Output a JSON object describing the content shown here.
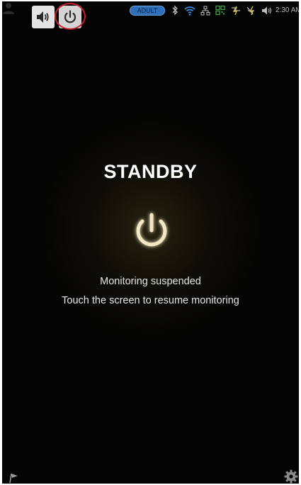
{
  "status_bar": {
    "patient_mode": "ADULT",
    "time": "2:30 AM",
    "icons": [
      "user-icon",
      "sound-icon",
      "standby-power-icon",
      "bluetooth-icon",
      "wifi-icon",
      "network-icon",
      "qr-icon",
      "battery-charge-icon",
      "battery-icon",
      "volume-icon"
    ]
  },
  "main": {
    "title": "STANDBY",
    "icon": "power-icon",
    "line1": "Monitoring suspended",
    "line2": "Touch the screen to resume monitoring"
  },
  "bottom_bar": {
    "icons": [
      "flag-icon",
      "settings-gear-icon"
    ]
  },
  "colors": {
    "background": "#040404",
    "glow": "#a08a3a",
    "power_icon": "#f3e8c4",
    "highlight": "#c8202a",
    "badge": "#2f6fb8"
  }
}
